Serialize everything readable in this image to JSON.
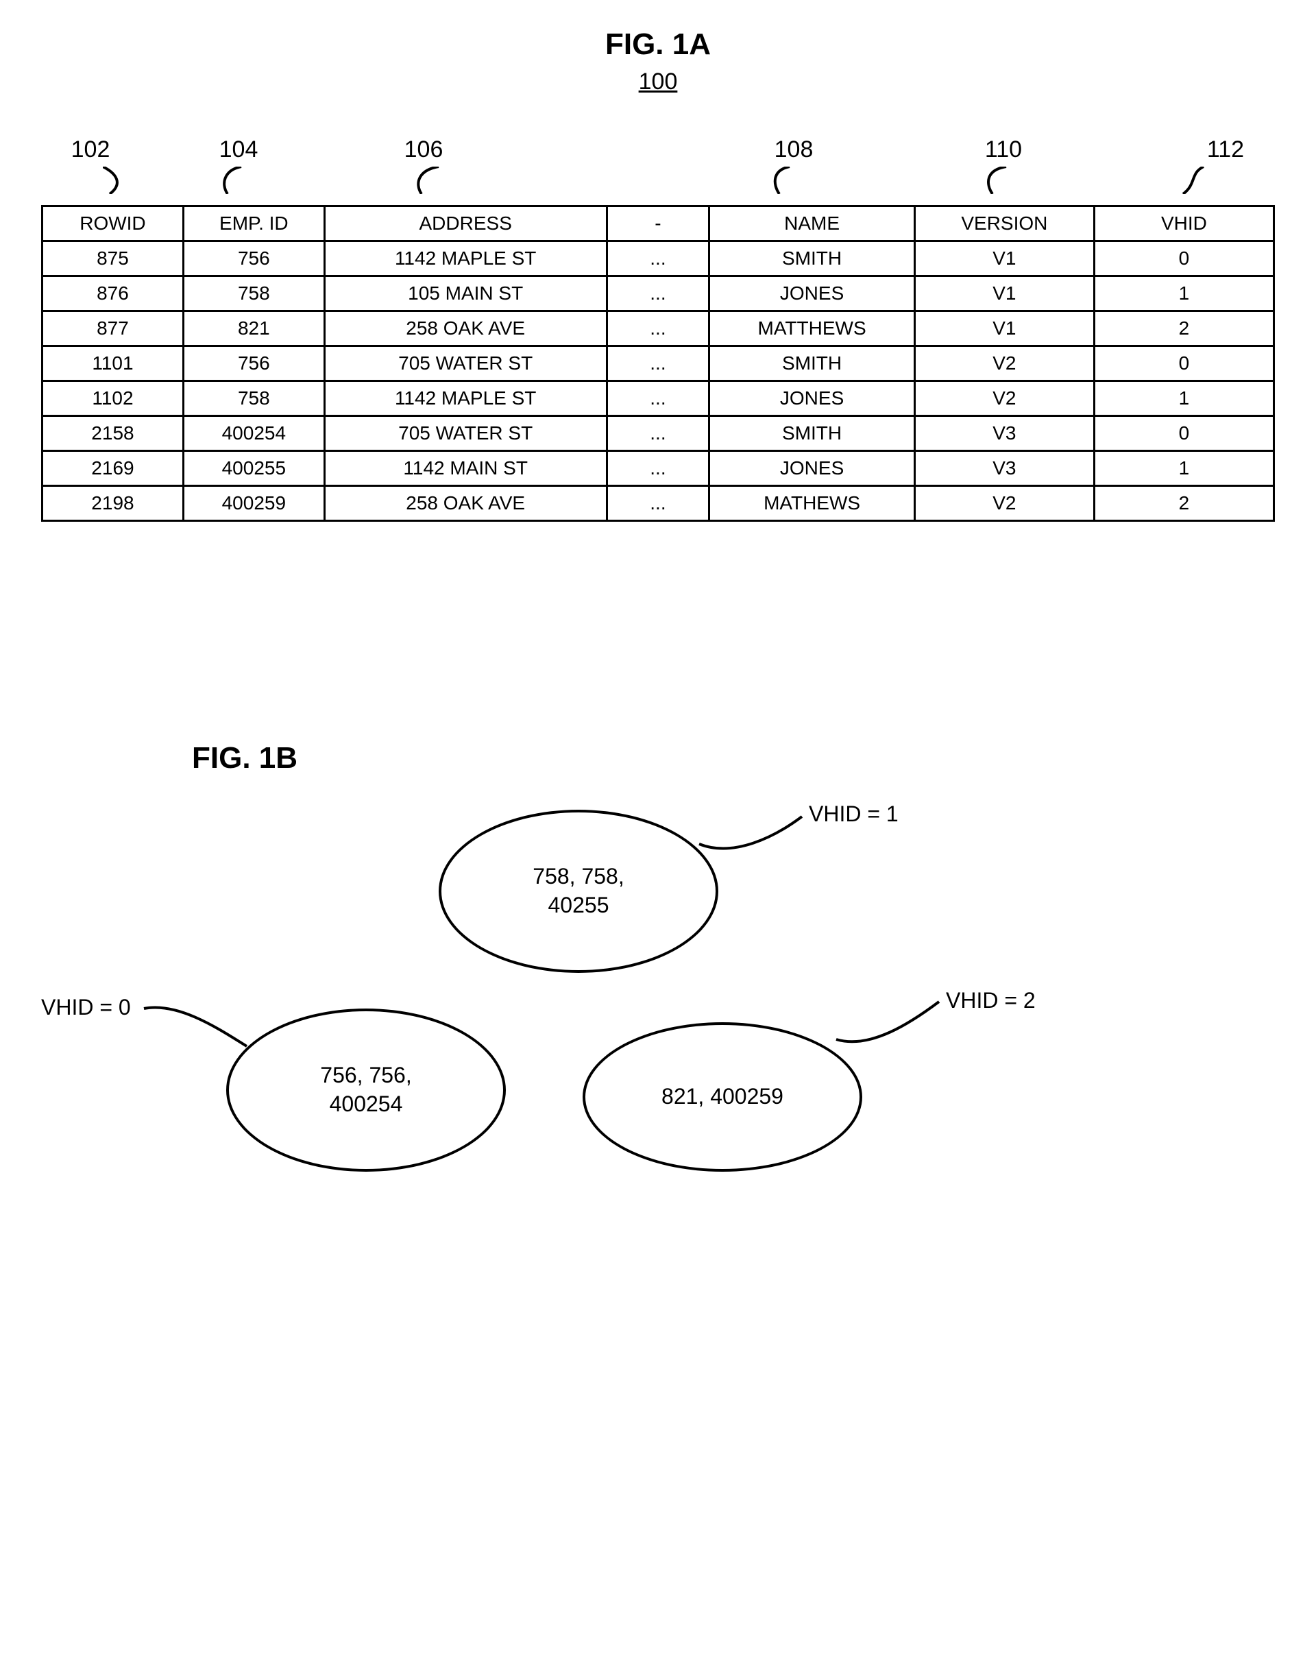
{
  "fig1a": {
    "title": "FIG. 1A",
    "ref": "100",
    "callouts": [
      "102",
      "104",
      "106",
      "108",
      "110",
      "112"
    ],
    "headers": [
      "ROWID",
      "EMP. ID",
      "ADDRESS",
      "-",
      "NAME",
      "VERSION",
      "VHID"
    ],
    "rows": [
      [
        "875",
        "756",
        "1142 MAPLE ST",
        "...",
        "SMITH",
        "V1",
        "0"
      ],
      [
        "876",
        "758",
        "105 MAIN ST",
        "...",
        "JONES",
        "V1",
        "1"
      ],
      [
        "877",
        "821",
        "258 OAK AVE",
        "...",
        "MATTHEWS",
        "V1",
        "2"
      ],
      [
        "1101",
        "756",
        "705 WATER ST",
        "...",
        "SMITH",
        "V2",
        "0"
      ],
      [
        "1102",
        "758",
        "1142 MAPLE ST",
        "...",
        "JONES",
        "V2",
        "1"
      ],
      [
        "2158",
        "400254",
        "705 WATER ST",
        "...",
        "SMITH",
        "V3",
        "0"
      ],
      [
        "2169",
        "400255",
        "1142 MAIN ST",
        "...",
        "JONES",
        "V3",
        "1"
      ],
      [
        "2198",
        "400259",
        "258 OAK AVE",
        "...",
        "MATHEWS",
        "V2",
        "2"
      ]
    ]
  },
  "fig1b": {
    "title": "FIG. 1B",
    "nodes": [
      {
        "content": "758, 758,\n40255",
        "label": "VHID = 1"
      },
      {
        "content": "756, 756,\n400254",
        "label": "VHID = 0"
      },
      {
        "content": "821, 400259",
        "label": "VHID = 2"
      }
    ]
  }
}
